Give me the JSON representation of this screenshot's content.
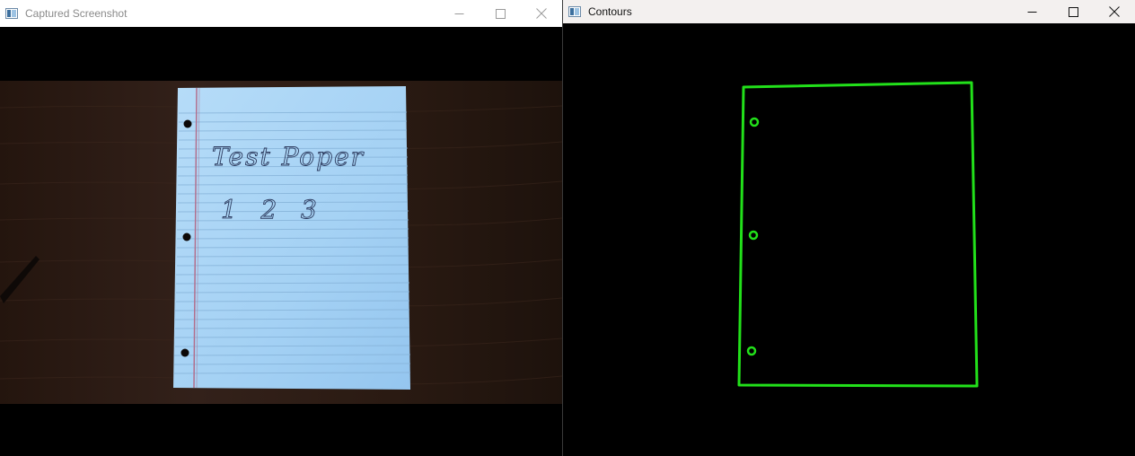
{
  "windows": {
    "left": {
      "title": "Captured Screenshot",
      "controls": [
        "minimize",
        "maximize",
        "close"
      ]
    },
    "right": {
      "title": "Contours",
      "controls": [
        "minimize",
        "maximize",
        "close"
      ]
    }
  },
  "capture": {
    "handwriting_line1": "Test Poper",
    "handwriting_line2": "1   2   3",
    "hole_count": 3
  },
  "contours": {
    "stroke_color": "#22e01a",
    "page_outline": "quadrilateral",
    "hole_circles": 3
  },
  "colors": {
    "paper": "#a9d4f5",
    "paper_shade": "#9ccbf0",
    "rule_line": "#7fa9d1",
    "margin_line": "#b06a86",
    "table_wood": "#2a1a13",
    "contour_green": "#22e01a"
  },
  "icons": {
    "app": "opencv-window-icon",
    "minimize": "minimize-icon",
    "maximize": "maximize-icon",
    "close": "close-icon"
  }
}
